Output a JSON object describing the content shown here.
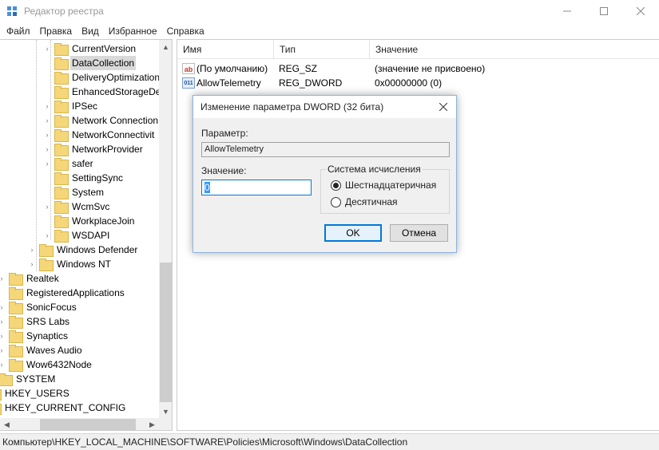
{
  "window": {
    "title": "Редактор реестра"
  },
  "menu": [
    "Файл",
    "Правка",
    "Вид",
    "Избранное",
    "Справка"
  ],
  "tree": {
    "items": [
      {
        "label": "CurrentVersion",
        "expandable": true,
        "selected": false
      },
      {
        "label": "DataCollection",
        "expandable": false,
        "selected": true
      },
      {
        "label": "DeliveryOptimization",
        "expandable": false,
        "selected": false
      },
      {
        "label": "EnhancedStorageDe",
        "expandable": false,
        "selected": false
      },
      {
        "label": "IPSec",
        "expandable": true,
        "selected": false
      },
      {
        "label": "Network Connection",
        "expandable": true,
        "selected": false
      },
      {
        "label": "NetworkConnectivit",
        "expandable": true,
        "selected": false
      },
      {
        "label": "NetworkProvider",
        "expandable": true,
        "selected": false
      },
      {
        "label": "safer",
        "expandable": true,
        "selected": false
      },
      {
        "label": "SettingSync",
        "expandable": false,
        "selected": false
      },
      {
        "label": "System",
        "expandable": false,
        "selected": false
      },
      {
        "label": "WcmSvc",
        "expandable": true,
        "selected": false
      },
      {
        "label": "WorkplaceJoin",
        "expandable": false,
        "selected": false
      },
      {
        "label": "WSDAPI",
        "expandable": true,
        "selected": false
      },
      {
        "label": "Windows Defender",
        "expandable": true,
        "selected": false
      },
      {
        "label": "Windows NT",
        "expandable": true,
        "selected": false
      },
      {
        "label": "Realtek",
        "expandable": true,
        "selected": false
      },
      {
        "label": "RegisteredApplications",
        "expandable": false,
        "selected": false
      },
      {
        "label": "SonicFocus",
        "expandable": true,
        "selected": false
      },
      {
        "label": "SRS Labs",
        "expandable": true,
        "selected": false
      },
      {
        "label": "Synaptics",
        "expandable": true,
        "selected": false
      },
      {
        "label": "Waves Audio",
        "expandable": true,
        "selected": false
      },
      {
        "label": "Wow6432Node",
        "expandable": true,
        "selected": false
      },
      {
        "label": "SYSTEM",
        "expandable": true,
        "selected": false
      },
      {
        "label": "HKEY_USERS",
        "expandable": true,
        "selected": false
      },
      {
        "label": "HKEY_CURRENT_CONFIG",
        "expandable": true,
        "selected": false
      }
    ]
  },
  "list": {
    "columns": [
      "Имя",
      "Тип",
      "Значение"
    ],
    "rows": [
      {
        "icon": "string-value-icon",
        "name": "(По умолчанию)",
        "type": "REG_SZ",
        "value": "(значение не присвоено)"
      },
      {
        "icon": "dword-value-icon",
        "name": "AllowTelemetry",
        "type": "REG_DWORD",
        "value": "0x00000000 (0)"
      }
    ]
  },
  "status": {
    "path": "Компьютер\\HKEY_LOCAL_MACHINE\\SOFTWARE\\Policies\\Microsoft\\Windows\\DataCollection"
  },
  "dialog": {
    "title": "Изменение параметра DWORD (32 бита)",
    "param_label": "Параметр:",
    "param_value": "AllowTelemetry",
    "value_label": "Значение:",
    "value": "0",
    "base_label": "Система исчисления",
    "radio_hex": "Шестнадцатеричная",
    "radio_dec": "Десятичная",
    "selected_base": "hex",
    "ok_label": "OK",
    "cancel_label": "Отмена"
  }
}
